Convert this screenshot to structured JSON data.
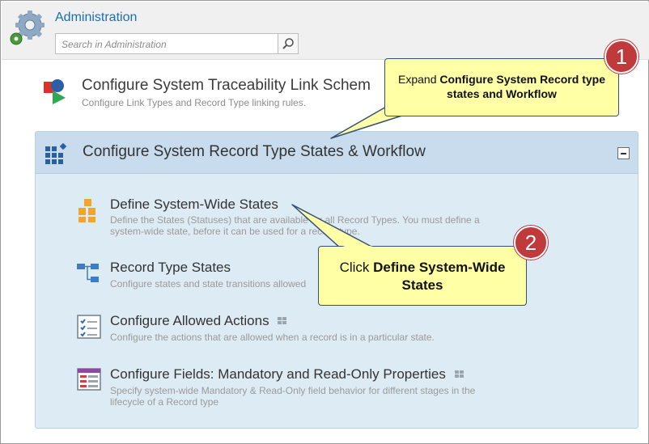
{
  "header": {
    "title": "Administration",
    "search_placeholder": "Search in Administration"
  },
  "link_schema": {
    "title": "Configure System Traceability Link Schem",
    "description": "Configure Link Types and Record Type linking rules."
  },
  "record_section": {
    "title": "Configure System Record Type States & Workflow",
    "items": [
      {
        "title": "Define System-Wide States",
        "description_line1": "Define the States (Statuses) that are available for all Record Types. You must define a",
        "description_line2": "system-wide state, before it can be used for a record type."
      },
      {
        "title": "Record Type States",
        "description_line1": "Configure states and state transitions allowed"
      },
      {
        "title": "Configure Allowed Actions",
        "description_line1": "Configure the actions that are allowed when a record is in a particular state."
      },
      {
        "title": "Configure Fields: Mandatory and Read-Only Properties",
        "description_line1": "Specify system-wide Mandatory & Read-Only field behavior for different stages in the",
        "description_line2": "lifecycle of a Record type"
      }
    ]
  },
  "callouts": [
    {
      "number": "1",
      "text_prefix": "Expand ",
      "text_bold": "Configure System Record type states and Workflow"
    },
    {
      "number": "2",
      "text_prefix": "Click ",
      "text_bold": "Define System-Wide States"
    }
  ],
  "colors": {
    "accent_blue": "#1a6fb4",
    "callout_fill": "#ffffa5",
    "badge_red": "#c0393b",
    "section_bg": "#ddebf4"
  }
}
